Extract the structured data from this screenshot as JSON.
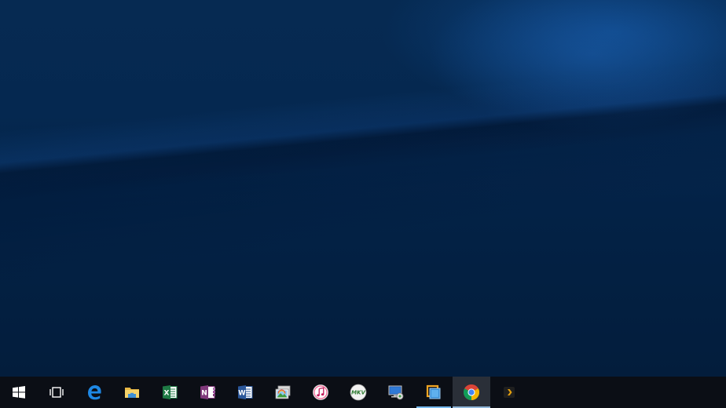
{
  "desktop": {
    "wallpaper": "windows-10-hero-dark-blue",
    "accent": "#76b9ed"
  },
  "taskbar": {
    "background": "#0b0e15",
    "items": [
      {
        "name": "start",
        "icon": "windows-logo-icon"
      },
      {
        "name": "task-view",
        "icon": "task-view-icon"
      },
      {
        "name": "edge",
        "icon": "edge-icon"
      },
      {
        "name": "file-explorer",
        "icon": "folder-icon"
      },
      {
        "name": "excel",
        "icon": "excel-icon",
        "glyph": "X"
      },
      {
        "name": "onenote",
        "icon": "onenote-icon",
        "glyph": "N"
      },
      {
        "name": "word",
        "icon": "word-icon",
        "glyph": "W"
      },
      {
        "name": "photo-viewer",
        "icon": "photo-viewer-icon"
      },
      {
        "name": "itunes",
        "icon": "itunes-icon"
      },
      {
        "name": "makemkv",
        "icon": "makemkv-icon",
        "glyph": "MKV"
      },
      {
        "name": "remote-desktop",
        "icon": "remote-desktop-icon"
      },
      {
        "name": "vmware",
        "icon": "vmware-icon",
        "running": true
      },
      {
        "name": "chrome",
        "icon": "chrome-icon",
        "running": true,
        "active": true
      },
      {
        "name": "plex",
        "icon": "plex-icon"
      }
    ]
  }
}
